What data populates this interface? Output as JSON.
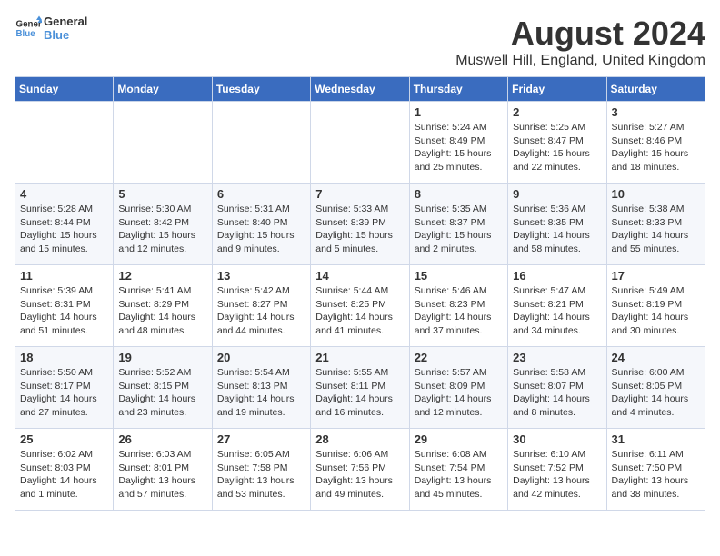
{
  "header": {
    "logo_general": "General",
    "logo_blue": "Blue",
    "title": "August 2024",
    "subtitle": "Muswell Hill, England, United Kingdom"
  },
  "days_of_week": [
    "Sunday",
    "Monday",
    "Tuesday",
    "Wednesday",
    "Thursday",
    "Friday",
    "Saturday"
  ],
  "weeks": [
    [
      {
        "day": "",
        "info": ""
      },
      {
        "day": "",
        "info": ""
      },
      {
        "day": "",
        "info": ""
      },
      {
        "day": "",
        "info": ""
      },
      {
        "day": "1",
        "info": "Sunrise: 5:24 AM\nSunset: 8:49 PM\nDaylight: 15 hours\nand 25 minutes."
      },
      {
        "day": "2",
        "info": "Sunrise: 5:25 AM\nSunset: 8:47 PM\nDaylight: 15 hours\nand 22 minutes."
      },
      {
        "day": "3",
        "info": "Sunrise: 5:27 AM\nSunset: 8:46 PM\nDaylight: 15 hours\nand 18 minutes."
      }
    ],
    [
      {
        "day": "4",
        "info": "Sunrise: 5:28 AM\nSunset: 8:44 PM\nDaylight: 15 hours\nand 15 minutes."
      },
      {
        "day": "5",
        "info": "Sunrise: 5:30 AM\nSunset: 8:42 PM\nDaylight: 15 hours\nand 12 minutes."
      },
      {
        "day": "6",
        "info": "Sunrise: 5:31 AM\nSunset: 8:40 PM\nDaylight: 15 hours\nand 9 minutes."
      },
      {
        "day": "7",
        "info": "Sunrise: 5:33 AM\nSunset: 8:39 PM\nDaylight: 15 hours\nand 5 minutes."
      },
      {
        "day": "8",
        "info": "Sunrise: 5:35 AM\nSunset: 8:37 PM\nDaylight: 15 hours\nand 2 minutes."
      },
      {
        "day": "9",
        "info": "Sunrise: 5:36 AM\nSunset: 8:35 PM\nDaylight: 14 hours\nand 58 minutes."
      },
      {
        "day": "10",
        "info": "Sunrise: 5:38 AM\nSunset: 8:33 PM\nDaylight: 14 hours\nand 55 minutes."
      }
    ],
    [
      {
        "day": "11",
        "info": "Sunrise: 5:39 AM\nSunset: 8:31 PM\nDaylight: 14 hours\nand 51 minutes."
      },
      {
        "day": "12",
        "info": "Sunrise: 5:41 AM\nSunset: 8:29 PM\nDaylight: 14 hours\nand 48 minutes."
      },
      {
        "day": "13",
        "info": "Sunrise: 5:42 AM\nSunset: 8:27 PM\nDaylight: 14 hours\nand 44 minutes."
      },
      {
        "day": "14",
        "info": "Sunrise: 5:44 AM\nSunset: 8:25 PM\nDaylight: 14 hours\nand 41 minutes."
      },
      {
        "day": "15",
        "info": "Sunrise: 5:46 AM\nSunset: 8:23 PM\nDaylight: 14 hours\nand 37 minutes."
      },
      {
        "day": "16",
        "info": "Sunrise: 5:47 AM\nSunset: 8:21 PM\nDaylight: 14 hours\nand 34 minutes."
      },
      {
        "day": "17",
        "info": "Sunrise: 5:49 AM\nSunset: 8:19 PM\nDaylight: 14 hours\nand 30 minutes."
      }
    ],
    [
      {
        "day": "18",
        "info": "Sunrise: 5:50 AM\nSunset: 8:17 PM\nDaylight: 14 hours\nand 27 minutes."
      },
      {
        "day": "19",
        "info": "Sunrise: 5:52 AM\nSunset: 8:15 PM\nDaylight: 14 hours\nand 23 minutes."
      },
      {
        "day": "20",
        "info": "Sunrise: 5:54 AM\nSunset: 8:13 PM\nDaylight: 14 hours\nand 19 minutes."
      },
      {
        "day": "21",
        "info": "Sunrise: 5:55 AM\nSunset: 8:11 PM\nDaylight: 14 hours\nand 16 minutes."
      },
      {
        "day": "22",
        "info": "Sunrise: 5:57 AM\nSunset: 8:09 PM\nDaylight: 14 hours\nand 12 minutes."
      },
      {
        "day": "23",
        "info": "Sunrise: 5:58 AM\nSunset: 8:07 PM\nDaylight: 14 hours\nand 8 minutes."
      },
      {
        "day": "24",
        "info": "Sunrise: 6:00 AM\nSunset: 8:05 PM\nDaylight: 14 hours\nand 4 minutes."
      }
    ],
    [
      {
        "day": "25",
        "info": "Sunrise: 6:02 AM\nSunset: 8:03 PM\nDaylight: 14 hours\nand 1 minute."
      },
      {
        "day": "26",
        "info": "Sunrise: 6:03 AM\nSunset: 8:01 PM\nDaylight: 13 hours\nand 57 minutes."
      },
      {
        "day": "27",
        "info": "Sunrise: 6:05 AM\nSunset: 7:58 PM\nDaylight: 13 hours\nand 53 minutes."
      },
      {
        "day": "28",
        "info": "Sunrise: 6:06 AM\nSunset: 7:56 PM\nDaylight: 13 hours\nand 49 minutes."
      },
      {
        "day": "29",
        "info": "Sunrise: 6:08 AM\nSunset: 7:54 PM\nDaylight: 13 hours\nand 45 minutes."
      },
      {
        "day": "30",
        "info": "Sunrise: 6:10 AM\nSunset: 7:52 PM\nDaylight: 13 hours\nand 42 minutes."
      },
      {
        "day": "31",
        "info": "Sunrise: 6:11 AM\nSunset: 7:50 PM\nDaylight: 13 hours\nand 38 minutes."
      }
    ]
  ]
}
